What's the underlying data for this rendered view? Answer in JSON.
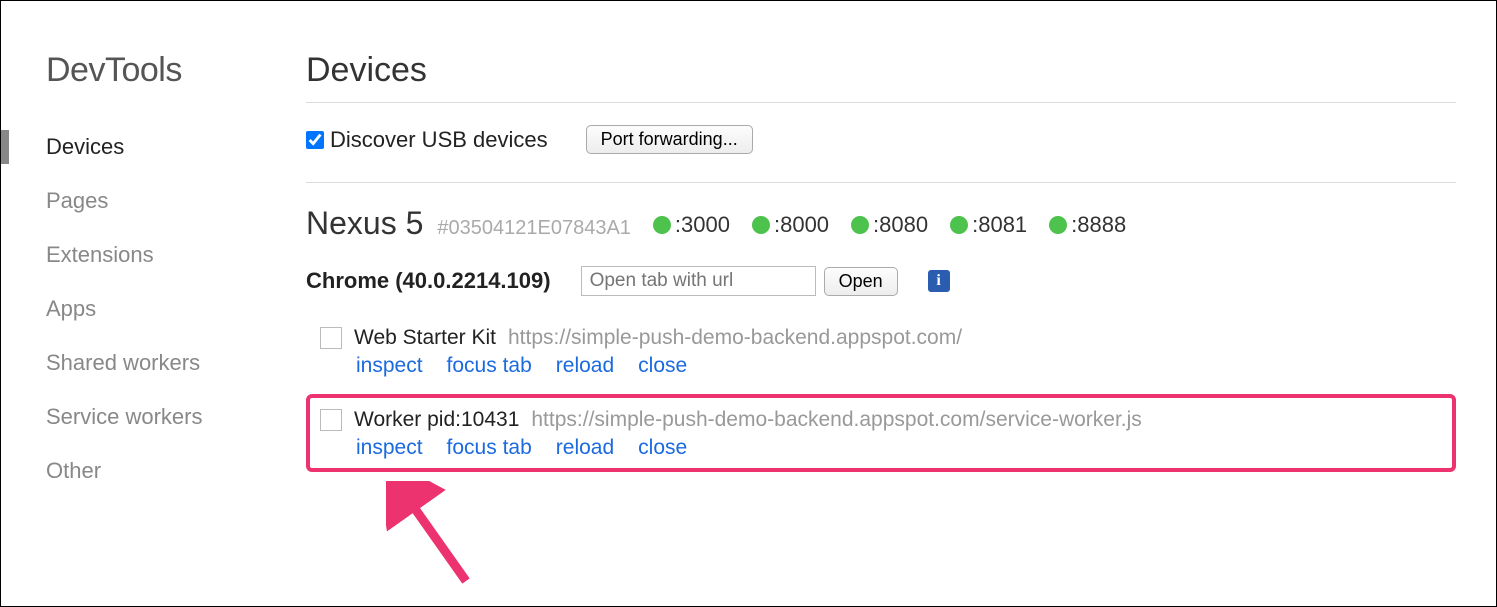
{
  "sidebar": {
    "title": "DevTools",
    "items": [
      {
        "label": "Devices",
        "key": "devices",
        "active": true
      },
      {
        "label": "Pages",
        "key": "pages",
        "active": false
      },
      {
        "label": "Extensions",
        "key": "extensions",
        "active": false
      },
      {
        "label": "Apps",
        "key": "apps",
        "active": false
      },
      {
        "label": "Shared workers",
        "key": "shared-workers",
        "active": false
      },
      {
        "label": "Service workers",
        "key": "service-workers",
        "active": false
      },
      {
        "label": "Other",
        "key": "other",
        "active": false
      }
    ]
  },
  "page": {
    "title": "Devices",
    "discover_label": "Discover USB devices",
    "discover_checked": true,
    "port_forwarding_label": "Port forwarding..."
  },
  "device": {
    "name": "Nexus 5",
    "id": "#03504121E07843A1",
    "ports": [
      ":3000",
      ":8000",
      ":8080",
      ":8081",
      ":8888"
    ]
  },
  "browser": {
    "label": "Chrome (40.0.2214.109)",
    "url_placeholder": "Open tab with url",
    "open_label": "Open"
  },
  "targets": [
    {
      "title": "Web Starter Kit",
      "url": "https://simple-push-demo-backend.appspot.com/",
      "highlighted": false,
      "actions": [
        "inspect",
        "focus tab",
        "reload",
        "close"
      ]
    },
    {
      "title": "Worker pid:10431",
      "url": "https://simple-push-demo-backend.appspot.com/service-worker.js",
      "highlighted": true,
      "actions": [
        "inspect",
        "focus tab",
        "reload",
        "close"
      ]
    }
  ]
}
